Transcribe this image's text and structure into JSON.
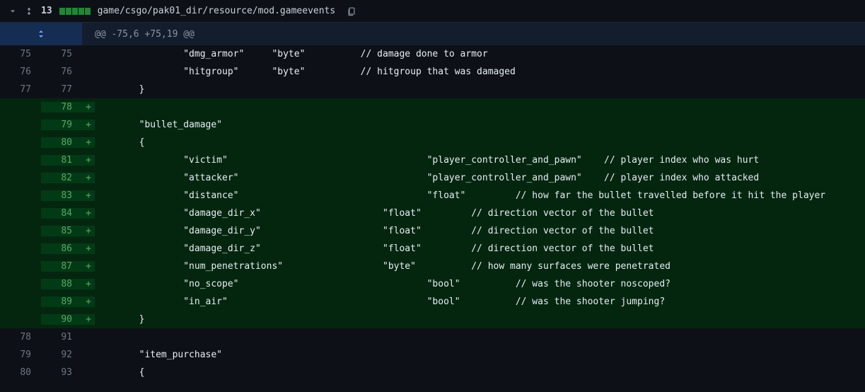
{
  "header": {
    "change_count": "13",
    "file_path": "game/csgo/pak01_dir/resource/mod.gameevents"
  },
  "hunk": {
    "text": "@@ -75,6 +75,19 @@"
  },
  "lines": [
    {
      "old": "75",
      "new": "75",
      "type": "ctx",
      "sign": " ",
      "code": "                \"dmg_armor\"     \"byte\"          // damage done to armor"
    },
    {
      "old": "76",
      "new": "76",
      "type": "ctx",
      "sign": " ",
      "code": "                \"hitgroup\"      \"byte\"          // hitgroup that was damaged"
    },
    {
      "old": "77",
      "new": "77",
      "type": "ctx",
      "sign": " ",
      "code": "        }"
    },
    {
      "old": "",
      "new": "78",
      "type": "add",
      "sign": "+",
      "code": ""
    },
    {
      "old": "",
      "new": "79",
      "type": "add",
      "sign": "+",
      "code": "        \"bullet_damage\""
    },
    {
      "old": "",
      "new": "80",
      "type": "add",
      "sign": "+",
      "code": "        {"
    },
    {
      "old": "",
      "new": "81",
      "type": "add",
      "sign": "+",
      "code": "                \"victim\"                                    \"player_controller_and_pawn\"    // player index who was hurt"
    },
    {
      "old": "",
      "new": "82",
      "type": "add",
      "sign": "+",
      "code": "                \"attacker\"                                  \"player_controller_and_pawn\"    // player index who attacked"
    },
    {
      "old": "",
      "new": "83",
      "type": "add",
      "sign": "+",
      "code": "                \"distance\"                                  \"float\"         // how far the bullet travelled before it hit the player"
    },
    {
      "old": "",
      "new": "84",
      "type": "add",
      "sign": "+",
      "code": "                \"damage_dir_x\"                      \"float\"         // direction vector of the bullet"
    },
    {
      "old": "",
      "new": "85",
      "type": "add",
      "sign": "+",
      "code": "                \"damage_dir_y\"                      \"float\"         // direction vector of the bullet"
    },
    {
      "old": "",
      "new": "86",
      "type": "add",
      "sign": "+",
      "code": "                \"damage_dir_z\"                      \"float\"         // direction vector of the bullet"
    },
    {
      "old": "",
      "new": "87",
      "type": "add",
      "sign": "+",
      "code": "                \"num_penetrations\"                  \"byte\"          // how many surfaces were penetrated"
    },
    {
      "old": "",
      "new": "88",
      "type": "add",
      "sign": "+",
      "code": "                \"no_scope\"                                  \"bool\"          // was the shooter noscoped?"
    },
    {
      "old": "",
      "new": "89",
      "type": "add",
      "sign": "+",
      "code": "                \"in_air\"                                    \"bool\"          // was the shooter jumping?"
    },
    {
      "old": "",
      "new": "90",
      "type": "add",
      "sign": "+",
      "code": "        }"
    },
    {
      "old": "78",
      "new": "91",
      "type": "ctx",
      "sign": " ",
      "code": ""
    },
    {
      "old": "79",
      "new": "92",
      "type": "ctx",
      "sign": " ",
      "code": "        \"item_purchase\""
    },
    {
      "old": "80",
      "new": "93",
      "type": "ctx",
      "sign": " ",
      "code": "        {"
    }
  ]
}
